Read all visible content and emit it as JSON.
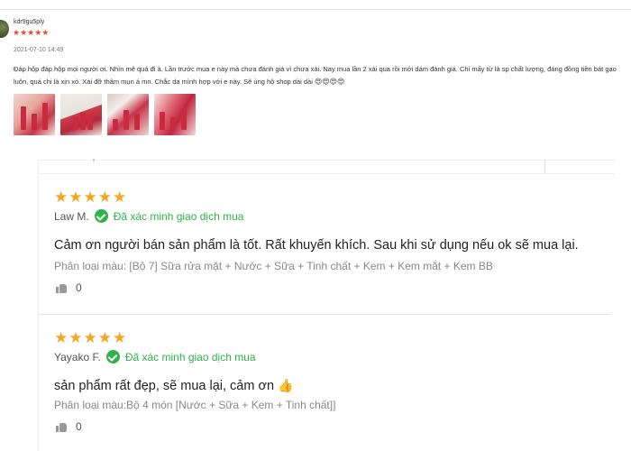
{
  "top_review": {
    "username": "kdr9gu5ply",
    "stars": "★★★★★",
    "datetime": "2021-07-10 14:49",
    "text": "Đáp hộp đáp hộp mọi người ơi. Nhìn mê quá đi à. Lần trước mua e này mà chưa đánh giá vì chưa xài. Nay mua lần 2 xài qua rồi mới dám đánh giá. Chỉ mấy từ là sp chất lượng, đáng đồng tiền bát gạo luôn, quá chi là xịn xò. Xài đỡ thâm mụn á mn. Chắc da mình hợp với e này. Sẽ ủng hộ shop dài dài",
    "emojis": "😍😍😍😍",
    "photos": [
      "photo-1",
      "photo-2",
      "photo-3",
      "photo-4"
    ]
  },
  "reviews": [
    {
      "stars": "★★★★★",
      "author": "Law M.",
      "verified_label": "Đã xác minh giao dịch mua",
      "content": "Cảm ơn người bán sản phẩm là tốt. Rất khuyến khích. Sau khi sử dụng nếu ok sẽ mua lại.",
      "variant": "Phân loại màu: [Bộ 7] Sữa rửa mặt + Nước + Sữa + Tinh chất + Kem + Kem mắt + Kem BB",
      "likes": "0"
    },
    {
      "stars": "★★★★★",
      "author": "Yayako F.",
      "verified_label": "Đã xác minh giao dịch mua",
      "content": "sản phẩm rất đẹp, sẽ mua lại, cảm ơn",
      "content_emoji": "👍",
      "variant": "Phân loại màu:Bộ 4 món [Nước + Sữa + Kem + Tinh chất]]",
      "likes": "0"
    }
  ],
  "colors": {
    "star_orange": "#f5a623",
    "star_red": "#ee4d2d",
    "verified_green": "#2fb34a"
  },
  "icons": [
    "verified-check-icon",
    "thumbs-up-icon",
    "avatar"
  ]
}
